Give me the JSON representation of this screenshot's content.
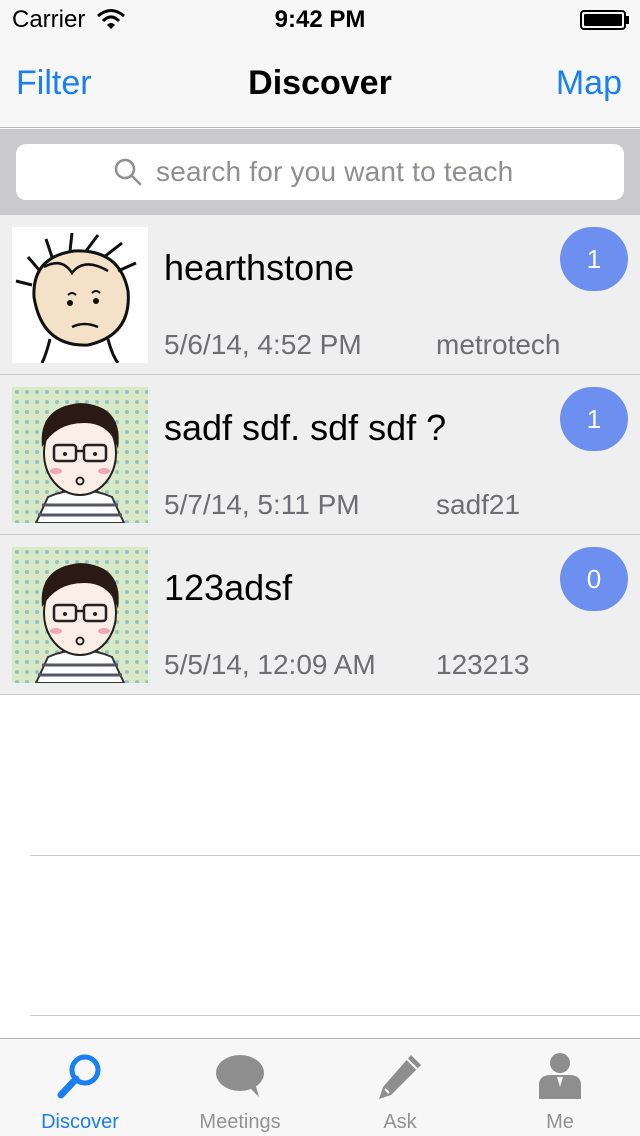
{
  "status_bar": {
    "carrier": "Carrier",
    "time": "9:42 PM"
  },
  "nav": {
    "left_button": "Filter",
    "title": "Discover",
    "right_button": "Map"
  },
  "search": {
    "placeholder": "search for you want to teach"
  },
  "rows": [
    {
      "title": "hearthstone",
      "date": "5/6/14, 4:52 PM",
      "user": "metrotech",
      "badge": "1",
      "avatar": "cartoon-bald-boy-avatar"
    },
    {
      "title": "sadf sdf. sdf sdf ?",
      "date": "5/7/14, 5:11 PM",
      "user": "sadf21",
      "badge": "1",
      "avatar": "cartoon-glasses-man-avatar"
    },
    {
      "title": "123adsf",
      "date": "5/5/14, 12:09 AM",
      "user": "123213",
      "badge": "0",
      "avatar": "cartoon-glasses-man-avatar"
    }
  ],
  "tabs": [
    {
      "label": "Discover",
      "icon": "magnifier-icon",
      "active": true
    },
    {
      "label": "Meetings",
      "icon": "speech-bubble-icon",
      "active": false
    },
    {
      "label": "Ask",
      "icon": "pencil-icon",
      "active": false
    },
    {
      "label": "Me",
      "icon": "person-icon",
      "active": false
    }
  ],
  "colors": {
    "accent": "#1a7ef5",
    "badge": "#6c8ff0",
    "row_background": "#efefef",
    "search_background": "#c9c9ce"
  }
}
